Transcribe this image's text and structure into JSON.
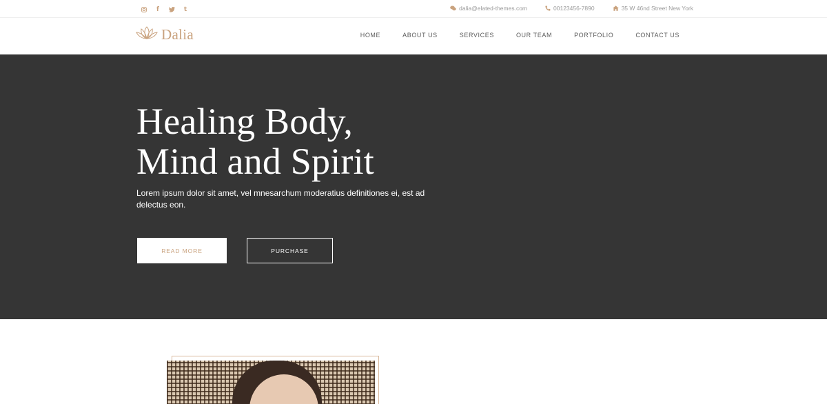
{
  "topbar": {
    "social_icons": [
      "instagram-icon",
      "facebook-icon",
      "twitter-icon",
      "tumblr-icon"
    ],
    "email": "dalia@elated-themes.com",
    "phone": "00123456-7890",
    "address": "35 W 46nd Street New York"
  },
  "header": {
    "logo_text": "Dalia",
    "nav": [
      "HOME",
      "ABOUT US",
      "SERVICES",
      "OUR TEAM",
      "PORTFOLIO",
      "CONTACT US"
    ]
  },
  "hero": {
    "title_line1": "Healing Body,",
    "title_line2": "Mind and Spirit",
    "description": "Lorem ipsum dolor sit amet, vel mnesarchum moderatius definitiones ei, est ad delectus eon.",
    "read_more": "READ MORE",
    "purchase": "PURCHASE"
  },
  "colors": {
    "accent": "#c9a27e",
    "hero_bg": "#353535",
    "white": "#ffffff"
  }
}
